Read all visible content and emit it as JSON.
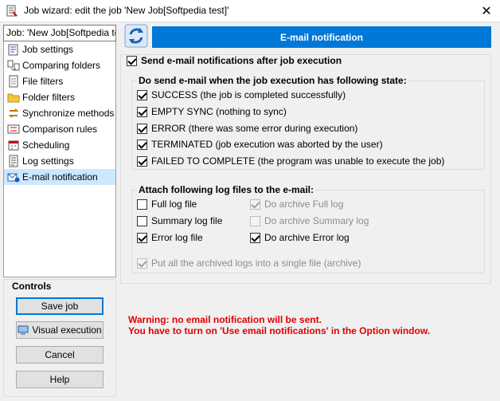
{
  "window": {
    "title": "Job wizard: edit the job 'New Job[Softpedia test]'",
    "close_glyph": "✕"
  },
  "job_label": "Job: 'New Job[Softpedia test]'",
  "header": {
    "title": "E-mail notification"
  },
  "sidebar": {
    "items": [
      {
        "label": "Job settings",
        "icon": "job-settings-icon",
        "selected": false
      },
      {
        "label": "Comparing folders",
        "icon": "compare-folders-icon",
        "selected": false
      },
      {
        "label": "File filters",
        "icon": "file-filters-icon",
        "selected": false
      },
      {
        "label": "Folder filters",
        "icon": "folder-filters-icon",
        "selected": false
      },
      {
        "label": "Synchronize methods",
        "icon": "sync-methods-icon",
        "selected": false
      },
      {
        "label": "Comparison rules",
        "icon": "comparison-rules-icon",
        "selected": false
      },
      {
        "label": "Scheduling",
        "icon": "scheduling-icon",
        "selected": false
      },
      {
        "label": "Log settings",
        "icon": "log-settings-icon",
        "selected": false
      },
      {
        "label": "E-mail notification",
        "icon": "email-notification-icon",
        "selected": true
      }
    ]
  },
  "controls": {
    "legend": "Controls",
    "save_job": "Save job",
    "visual_execution": "Visual execution",
    "cancel": "Cancel",
    "help": "Help"
  },
  "main": {
    "send_email": {
      "label": "Send e-mail notifications after job execution",
      "checked": true
    },
    "state_group": {
      "title": "Do send e-mail when the job execution has following state:",
      "options": [
        {
          "label": "SUCCESS (the job is completed successfully)",
          "checked": true
        },
        {
          "label": "EMPTY SYNC (nothing to sync)",
          "checked": true
        },
        {
          "label": "ERROR (there was some error during execution)",
          "checked": true
        },
        {
          "label": "TERMINATED (job execution was aborted by the user)",
          "checked": true
        },
        {
          "label": "FAILED TO COMPLETE (the program was unable to execute the job)",
          "checked": true
        }
      ]
    },
    "attach_group": {
      "title": "Attach following log files to the e-mail:",
      "full_log": {
        "label": "Full log file",
        "checked": false
      },
      "archive_full_log": {
        "label": "Do archive Full log",
        "checked": true,
        "disabled": true
      },
      "summary_log": {
        "label": "Summary log file",
        "checked": false
      },
      "archive_summary_log": {
        "label": "Do archive Summary log",
        "checked": false,
        "disabled": true
      },
      "error_log": {
        "label": "Error log file",
        "checked": true
      },
      "archive_error_log": {
        "label": "Do archive Error log",
        "checked": true,
        "disabled": false
      },
      "single_archive": {
        "label": "Put all the archived logs into a single file (archive)",
        "checked": true,
        "disabled": true
      }
    }
  },
  "warning": {
    "line1": "Warning: no email notification will be sent.",
    "line2": "You have to turn on 'Use email notifications' in the Option window."
  },
  "colors": {
    "accent": "#0078d7",
    "warning": "#e00000",
    "selection": "#cce8ff"
  }
}
